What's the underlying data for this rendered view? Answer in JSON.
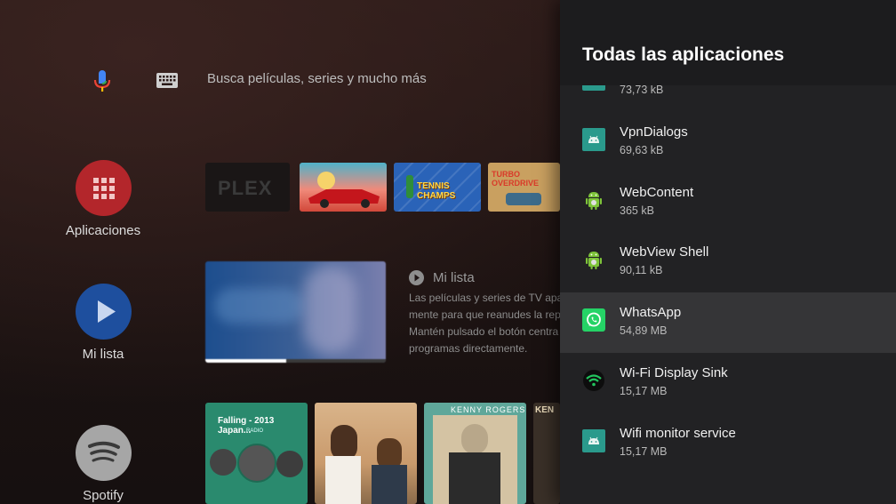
{
  "search": {
    "placeholder": "Busca películas, series y mucho más"
  },
  "nav": {
    "apps_label": "Aplicaciones",
    "watchlist_label": "Mi lista",
    "spotify_label": "Spotify"
  },
  "row_apps": {
    "tiles": [
      "PLEX",
      "",
      "TENNIS CHAMPS",
      "TURBO OVERDRIVE"
    ]
  },
  "watchlist": {
    "title": "Mi lista",
    "description_lines": [
      "Las películas y series de TV apar",
      "mente para que reanudes la rep",
      "Mantén pulsado el botón centra",
      "programas directamente."
    ],
    "progress": 0.45
  },
  "spotify_row": {
    "tiles": [
      {
        "title": "Falling - 2013 Japan...",
        "subtitle": "RADIO"
      },
      {
        "title": ""
      },
      {
        "title": "KENNY ROGERS"
      },
      {
        "title": "KEN"
      }
    ]
  },
  "panel": {
    "title": "Todas las aplicaciones",
    "apps": [
      {
        "name": "",
        "size": "73,73 kB",
        "icon": "android-box-icon"
      },
      {
        "name": "VpnDialogs",
        "size": "69,63 kB",
        "icon": "android-box-icon"
      },
      {
        "name": "WebContent",
        "size": "365 kB",
        "icon": "android-robot-icon"
      },
      {
        "name": "WebView Shell",
        "size": "90,11 kB",
        "icon": "android-robot-icon"
      },
      {
        "name": "WhatsApp",
        "size": "54,89 MB",
        "icon": "whatsapp-icon"
      },
      {
        "name": "Wi-Fi Display Sink",
        "size": "15,17 MB",
        "icon": "wifi-icon"
      },
      {
        "name": "Wifi monitor service",
        "size": "15,17 MB",
        "icon": "android-box-icon"
      }
    ]
  },
  "colors": {
    "apps_button": "#b3262b",
    "watchlist_button": "#1e4f9e",
    "spotify_button": "#a6a6a6",
    "whatsapp": "#25d366",
    "android_green": "#7ec43a",
    "android_box": "#2a9a8c"
  }
}
